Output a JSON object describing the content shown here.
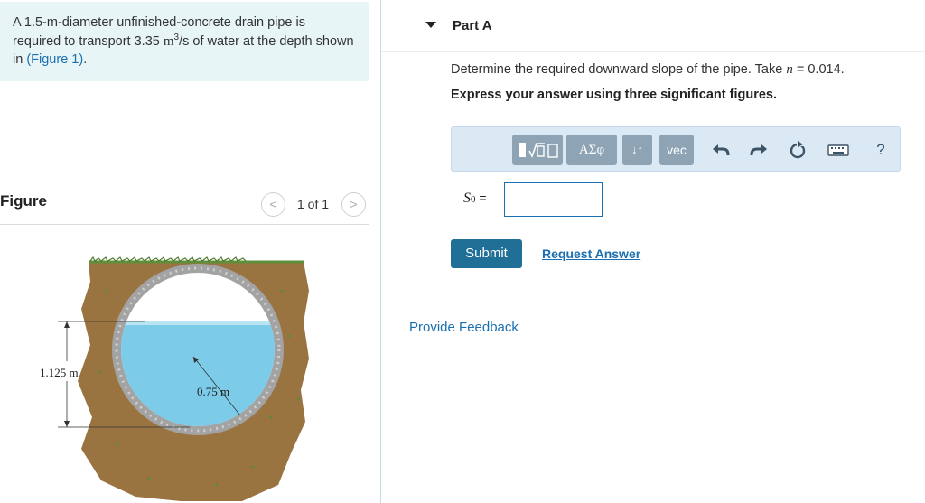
{
  "problem": {
    "text_part1": "A 1.5-m-diameter unfinished-concrete drain pipe is required to transport 3.35 ",
    "unit_m": "m",
    "unit_exp": "3",
    "text_part2": "/s of water at the depth shown in ",
    "figure_link": "(Figure 1)",
    "text_part3": "."
  },
  "figure": {
    "title": "Figure",
    "page": "1 of 1",
    "prev_icon": "chevron-left-icon",
    "next_icon": "chevron-right-icon",
    "depth_label": "1.125 m",
    "radius_label": "0.75 m",
    "colors": {
      "soil": "#9a7440",
      "water": "#7ccbe8",
      "pipe": "#9a9a9a",
      "grass": "#5e8f3a"
    }
  },
  "part": {
    "title": "Part A",
    "question_pre": "Determine the required downward slope of the pipe. Take ",
    "question_var": "n",
    "question_post": " = 0.014.",
    "instruction": "Express your answer using three significant figures."
  },
  "toolbar": {
    "templates_icon": "sqrt-template-icon",
    "greek": "ΑΣφ",
    "arrows": "↓↑",
    "vec": "vec",
    "undo_icon": "undo-icon",
    "redo_icon": "redo-icon",
    "reset_icon": "reset-icon",
    "keyboard_icon": "keyboard-icon",
    "help": "?"
  },
  "answer": {
    "symbol": "S",
    "subscript": "0",
    "equals": " =",
    "value": ""
  },
  "actions": {
    "submit": "Submit",
    "request": "Request Answer",
    "feedback": "Provide Feedback"
  },
  "colors": {
    "accent": "#1a6fb0",
    "submit_bg": "#1f6f96",
    "problem_bg": "#e8f5f7"
  }
}
